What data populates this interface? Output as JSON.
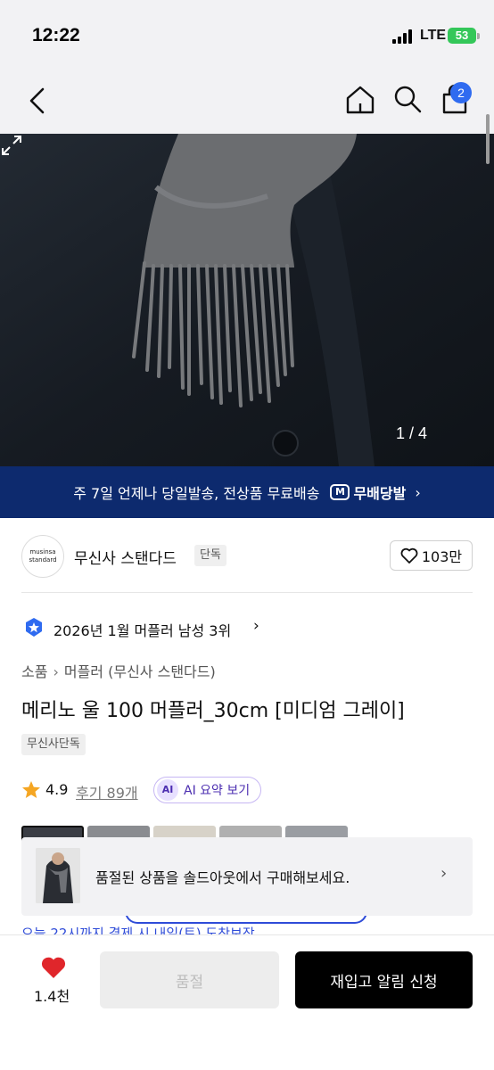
{
  "status_bar": {
    "time": "12:22",
    "network": "LTE",
    "battery": "53"
  },
  "nav": {
    "cart_count": "2"
  },
  "hero": {
    "counter": "1 / 4"
  },
  "promo": {
    "text": "주 7일 언제나 당일발송, 전상품 무료배송",
    "logo_label": "무배당발",
    "arrow": "›"
  },
  "brand": {
    "logo_text_top": "musinsa",
    "logo_text_bottom": "standard",
    "name": "무신사 스탠다드",
    "tag": "단독",
    "likes": "103만"
  },
  "ranking": {
    "text": "2026년 1월 머플러 남성 3위",
    "arrow": "›"
  },
  "breadcrumb": {
    "category": "소품",
    "separator": "›",
    "subcategory": "머플러 (무신사 스탠다드)"
  },
  "product": {
    "title": "메리노 울 100 머플러_30cm [미디엄 그레이]",
    "tag": "무신사단독"
  },
  "rating": {
    "score": "4.9",
    "reviews": "후기 89개",
    "ai_badge": "AI",
    "ai_label": "AI 요약 보기"
  },
  "popup": {
    "text": "품절된 상품을 솔드아웃에서 구매해보세요.",
    "arrow": "›"
  },
  "peek": {
    "text": "오늘 22시까지 결제 시 내일(토) 도착보장"
  },
  "bottom": {
    "wish_count": "1.4천",
    "soldout_label": "품절",
    "restock_label": "재입고 알림 신청"
  },
  "colors": {
    "accent_blue": "#2f6bf0",
    "promo_bg": "#0d2a6e",
    "heart_red": "#e0262b",
    "star_orange": "#f5a623"
  }
}
